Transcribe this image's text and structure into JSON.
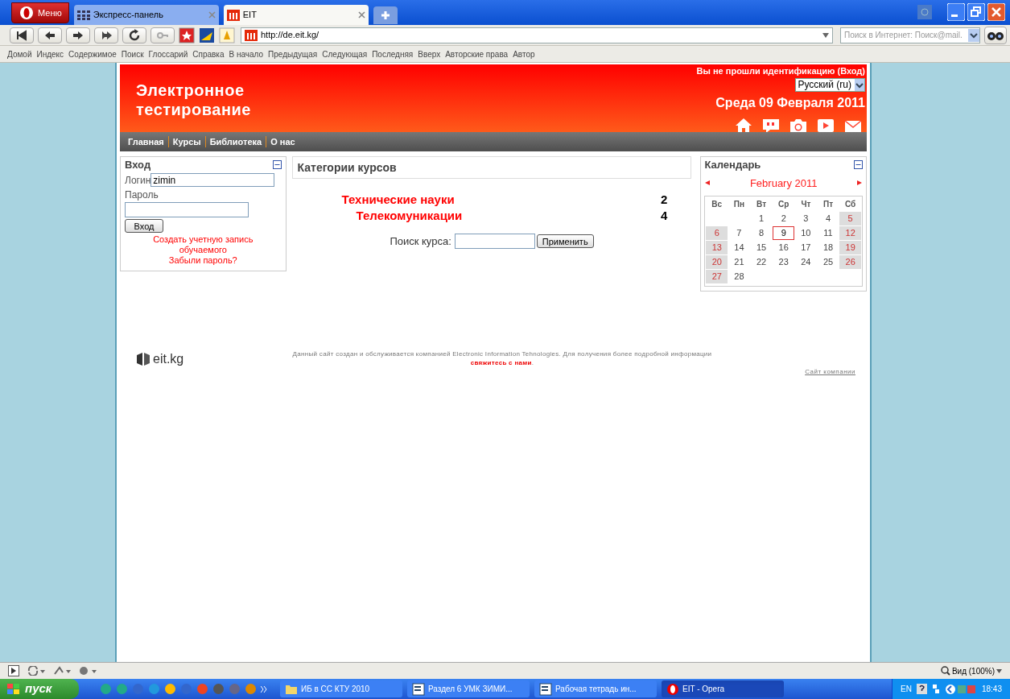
{
  "browser": {
    "menu_button": "Меню",
    "tabs": [
      {
        "label": "Экспресс-панель",
        "selected": false
      },
      {
        "label": "EIT",
        "selected": true
      }
    ],
    "address": "http://de.eit.kg/",
    "search": {
      "placeholder": "Поиск в Интернет: Поиск@mail."
    },
    "bookmarks": [
      "Домой",
      "Индекс",
      "Содержимое",
      "Поиск",
      "Глоссарий",
      "Справка",
      "В начало",
      "Предыдущая",
      "Следующая",
      "Последняя",
      "Вверх",
      "Авторские права",
      "Автор"
    ],
    "zoom": "Вид (100%)"
  },
  "header": {
    "title": "Электронное тестирование",
    "login_status": "Вы не прошли идентификацию (Вход)",
    "language": "Русский (ru)",
    "date": "Среда 09 Февраля 2011"
  },
  "menu": [
    "Главная",
    "Курсы",
    "Библиотека",
    "О нас"
  ],
  "login_block": {
    "title": "Вход",
    "login_label": "Логин",
    "login_value": "zimin",
    "password_label": "Пароль",
    "button": "Вход",
    "links": [
      "Создать учетную запись обучаемого",
      "Забыли пароль?"
    ]
  },
  "categories": {
    "title": "Категории курсов",
    "items": [
      {
        "name": "Технические науки",
        "count": "2",
        "children": [
          {
            "name": "Телекомуникации",
            "count": "4"
          }
        ]
      }
    ],
    "search_label": "Поиск курса:",
    "search_button": "Применить"
  },
  "calendar": {
    "title": "Календарь",
    "month": "February 2011",
    "weekdays": [
      "Вс",
      "Пн",
      "Вт",
      "Ср",
      "Чт",
      "Пт",
      "Сб"
    ],
    "weeks": [
      [
        {
          "day": "1",
          "weekend": false,
          "today": false
        },
        {
          "day": "2",
          "weekend": false,
          "today": false
        },
        {
          "day": "3",
          "weekend": false,
          "today": false
        },
        {
          "day": "4",
          "weekend": false,
          "today": false
        },
        {
          "day": "5",
          "weekend": true,
          "today": false
        }
      ],
      [
        {
          "day": "6",
          "weekend": true,
          "today": false
        },
        {
          "day": "7",
          "weekend": false,
          "today": false
        },
        {
          "day": "8",
          "weekend": false,
          "today": false
        },
        {
          "day": "9",
          "weekend": false,
          "today": true
        },
        {
          "day": "10",
          "weekend": false,
          "today": false
        },
        {
          "day": "11",
          "weekend": false,
          "today": false
        },
        {
          "day": "12",
          "weekend": true,
          "today": false
        }
      ],
      [
        {
          "day": "13",
          "weekend": true,
          "today": false
        },
        {
          "day": "14",
          "weekend": false,
          "today": false
        },
        {
          "day": "15",
          "weekend": false,
          "today": false
        },
        {
          "day": "16",
          "weekend": false,
          "today": false
        },
        {
          "day": "17",
          "weekend": false,
          "today": false
        },
        {
          "day": "18",
          "weekend": false,
          "today": false
        },
        {
          "day": "19",
          "weekend": true,
          "today": false
        }
      ],
      [
        {
          "day": "20",
          "weekend": true,
          "today": false
        },
        {
          "day": "21",
          "weekend": false,
          "today": false
        },
        {
          "day": "22",
          "weekend": false,
          "today": false
        },
        {
          "day": "23",
          "weekend": false,
          "today": false
        },
        {
          "day": "24",
          "weekend": false,
          "today": false
        },
        {
          "day": "25",
          "weekend": false,
          "today": false
        },
        {
          "day": "26",
          "weekend": true,
          "today": false
        }
      ],
      [
        {
          "day": "27",
          "weekend": true,
          "today": false
        },
        {
          "day": "28",
          "weekend": false,
          "today": false
        }
      ]
    ]
  },
  "footer": {
    "logo": "eit.kg",
    "text": "Данный сайт создан и обслуживается компанией Electronic Information Tehnologies. Для получения более подробной информации",
    "link": "свяжитесь с нами",
    "text_after": ".",
    "company_link": "Сайт компании"
  },
  "taskbar": {
    "start": "пуск",
    "tasks": [
      {
        "label": "ИБ в СС КТУ 2010",
        "kind": "folder",
        "selected": false
      },
      {
        "label": "Раздел 6 УМК ЗИМИ...",
        "kind": "document",
        "selected": false
      },
      {
        "label": "Рабочая тетрадь ин...",
        "kind": "document",
        "selected": false
      },
      {
        "label": "EIT - Opera",
        "kind": "opera",
        "selected": true
      }
    ],
    "language": "EN",
    "time": "18:43"
  }
}
